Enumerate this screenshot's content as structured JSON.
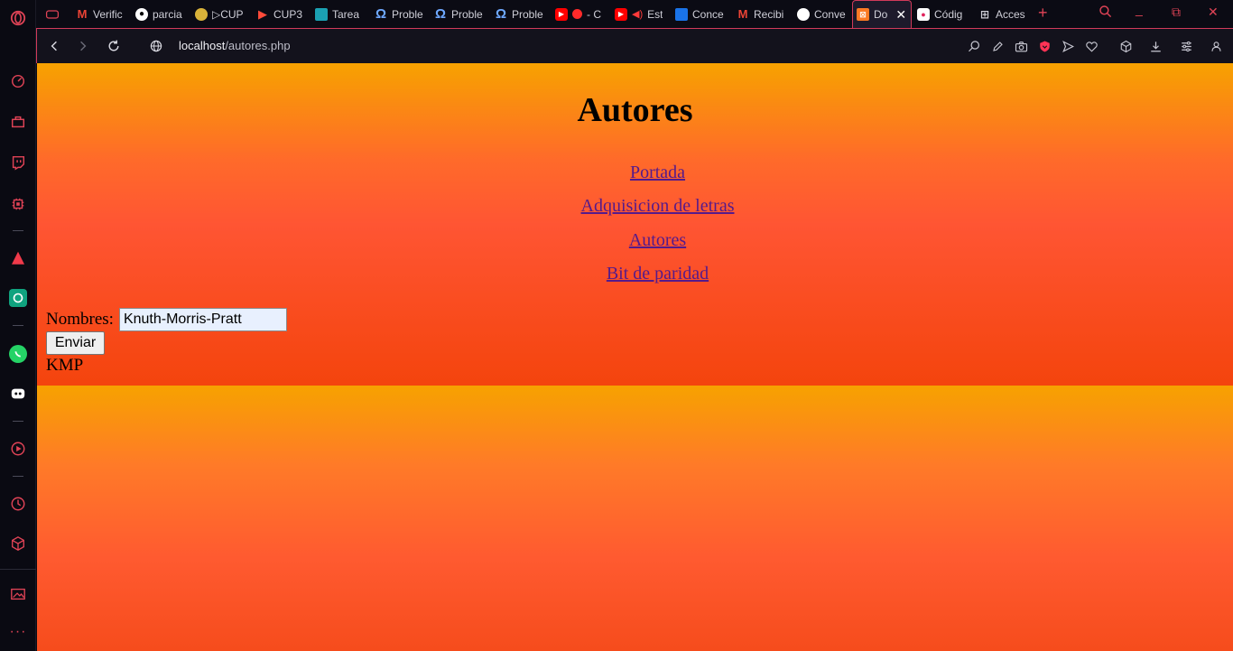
{
  "browser": {
    "tabs": [
      {
        "title": "Verific",
        "icon": "gmail-icon"
      },
      {
        "title": "parcia",
        "icon": "github-icon"
      },
      {
        "title": "▷CUP",
        "icon": "owl-icon"
      },
      {
        "title": "CUP3",
        "icon": "cup-icon"
      },
      {
        "title": "Tarea",
        "icon": "classroom-icon"
      },
      {
        "title": "Proble",
        "icon": "omega-icon"
      },
      {
        "title": "Proble",
        "icon": "omega-icon"
      },
      {
        "title": "Proble",
        "icon": "omega-icon"
      },
      {
        "title": "- C",
        "icon": "youtube-icon"
      },
      {
        "title": "Est",
        "icon": "youtube-icon"
      },
      {
        "title": "Conce",
        "icon": "contacts-icon"
      },
      {
        "title": "Recibi",
        "icon": "gmail-icon"
      },
      {
        "title": "Conve",
        "icon": "chatgpt-icon"
      },
      {
        "title": "Do",
        "icon": "xampp-icon"
      },
      {
        "title": "Códig",
        "icon": "record-icon"
      },
      {
        "title": "Acces",
        "icon": "grid-icon"
      }
    ],
    "active_tab_index": 13,
    "url_host": "localhost",
    "url_path": "/autores.php"
  },
  "page": {
    "title": "Autores",
    "nav_links": [
      "Portada",
      "Adquisicion de letras",
      "Autores",
      "Bit de paridad"
    ],
    "form": {
      "label": "Nombres:",
      "input_value": "Knuth-Morris-Pratt",
      "submit_label": "Enviar"
    },
    "result": "KMP"
  },
  "colors": {
    "accent": "#e04356",
    "link": "#551a8b",
    "gradient_top": "#f7a200",
    "gradient_bottom": "#f4440d"
  }
}
